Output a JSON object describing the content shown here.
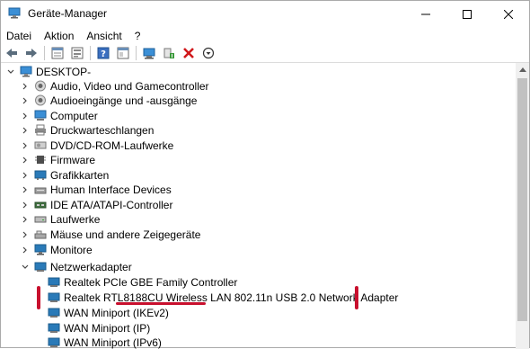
{
  "window": {
    "title": "Geräte-Manager",
    "minimize_glyph": "—",
    "maximize_glyph": "☐",
    "close_glyph": "✕"
  },
  "menu": [
    "Datei",
    "Aktion",
    "Ansicht",
    "?"
  ],
  "toolbar": {
    "buttons": [
      "back-icon",
      "forward-icon",
      "properties-icon",
      "show-hidden-icon",
      "help-icon",
      "console-icon",
      "scan-hardware-icon",
      "update-driver-icon",
      "uninstall-icon",
      "disable-icon"
    ]
  },
  "tree": {
    "root": "DESKTOP-",
    "categories": [
      {
        "label": "Audio, Video und Gamecontroller",
        "icon": "speaker-icon"
      },
      {
        "label": "Audioeingänge und -ausgänge",
        "icon": "speaker-icon"
      },
      {
        "label": "Computer",
        "icon": "computer-icon"
      },
      {
        "label": "Druckwarteschlangen",
        "icon": "printer-icon"
      },
      {
        "label": "DVD/CD-ROM-Laufwerke",
        "icon": "disc-drive-icon"
      },
      {
        "label": "Firmware",
        "icon": "chip-icon"
      },
      {
        "label": "Grafikkarten",
        "icon": "display-adapter-icon"
      },
      {
        "label": "Human Interface Devices",
        "icon": "hid-icon"
      },
      {
        "label": "IDE ATA/ATAPI-Controller",
        "icon": "ide-controller-icon"
      },
      {
        "label": "Laufwerke",
        "icon": "drive-icon"
      },
      {
        "label": "Mäuse und andere Zeigegeräte",
        "icon": "mouse-icon"
      },
      {
        "label": "Monitore",
        "icon": "monitor-icon"
      },
      {
        "label": "Netzwerkadapter",
        "icon": "network-icon"
      }
    ],
    "network_adapters": [
      "Realtek PCIe GBE Family Controller",
      "Realtek RTL8188CU Wireless LAN 802.11n USB 2.0 Network Adapter",
      "WAN Miniport (IKEv2)",
      "WAN Miniport (IP)",
      "WAN Miniport (IPv6)"
    ]
  },
  "colors": {
    "annotation_red": "#c8102e",
    "icon_blue": "#2a7ab8"
  }
}
